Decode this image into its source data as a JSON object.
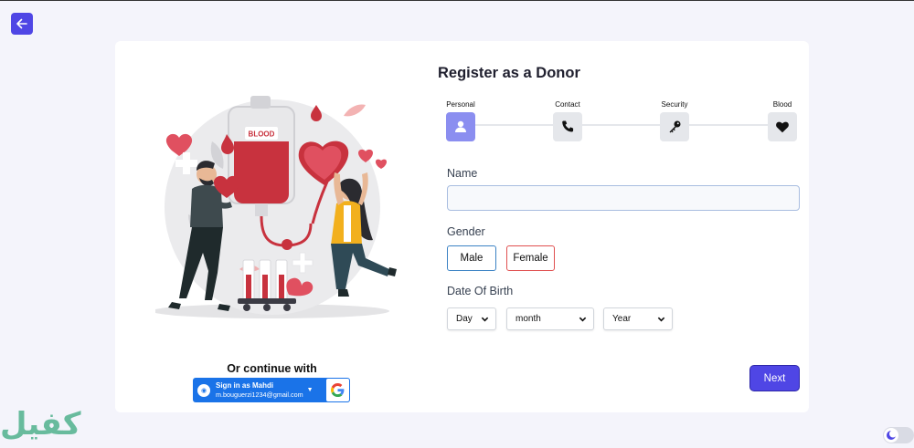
{
  "form": {
    "title": "Register as a Donor",
    "steps": [
      {
        "label": "Personal",
        "icon": "user-icon"
      },
      {
        "label": "Contact",
        "icon": "phone-icon"
      },
      {
        "label": "Security",
        "icon": "key-icon"
      },
      {
        "label": "Blood",
        "icon": "heart-icon"
      }
    ],
    "name_label": "Name",
    "name_value": "",
    "gender_label": "Gender",
    "gender_options": [
      "Male",
      "Female"
    ],
    "dob_label": "Date Of Birth",
    "dob_selects": {
      "day": "Day",
      "month": "month",
      "year": "Year"
    },
    "next_label": "Next"
  },
  "illustration": {
    "bag_label": "BLOOD"
  },
  "social": {
    "continue_label": "Or continue with",
    "google_name": "Sign in as Mahdi",
    "google_email": "m.bouguerzi1234@gmail.com"
  },
  "watermark": "كفيل",
  "colors": {
    "accent": "#4f46e5",
    "step_active": "#8b8ef0",
    "blood_red": "#c8323e",
    "google_blue": "#1a73e8",
    "male_border": "#3b82c4",
    "female_border": "#e05050"
  }
}
